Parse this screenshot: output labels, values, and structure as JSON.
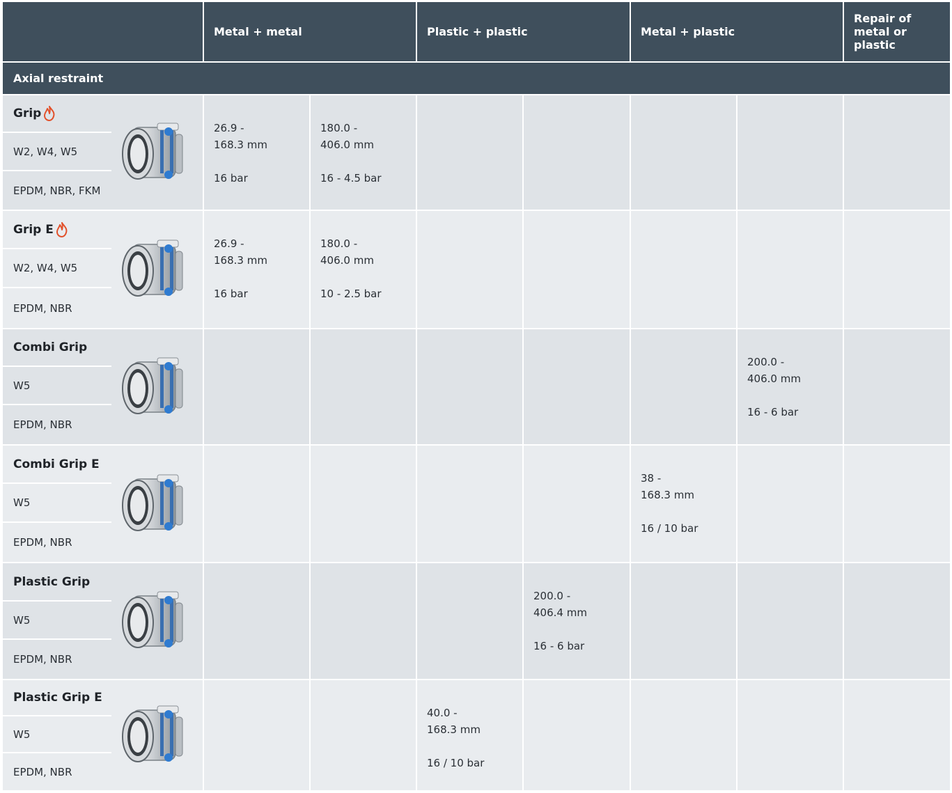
{
  "header": {
    "columns": [
      "Metal + metal",
      "Plastic + plastic",
      "Metal + plastic",
      "Repair of metal or plastic"
    ]
  },
  "section": {
    "title": "Axial restraint"
  },
  "rows": [
    {
      "name": "Grip",
      "flame": true,
      "variants": "W2, W4, W5",
      "materials": "EPDM, NBR, FKM",
      "image": "coupling-image",
      "cells": [
        {
          "col": 0,
          "range": [
            "26.9 -",
            "168.3 mm"
          ],
          "pressure": "16 bar"
        },
        {
          "col": 1,
          "range": [
            "180.0 -",
            "406.0 mm"
          ],
          "pressure": "16 - 4.5 bar"
        }
      ]
    },
    {
      "name": "Grip E",
      "flame": true,
      "variants": "W2, W4, W5",
      "materials": "EPDM, NBR",
      "image": "coupling-image",
      "cells": [
        {
          "col": 0,
          "range": [
            "26.9 -",
            "168.3 mm"
          ],
          "pressure": "16 bar"
        },
        {
          "col": 1,
          "range": [
            "180.0 -",
            "406.0 mm"
          ],
          "pressure": "10 - 2.5 bar"
        }
      ]
    },
    {
      "name": "Combi Grip",
      "flame": false,
      "variants": "W5",
      "materials": "EPDM, NBR",
      "image": "coupling-image",
      "cells": [
        {
          "col": 5,
          "range": [
            "200.0 -",
            "406.0 mm"
          ],
          "pressure": "16 - 6 bar"
        }
      ]
    },
    {
      "name": "Combi Grip E",
      "flame": false,
      "variants": "W5",
      "materials": "EPDM, NBR",
      "image": "coupling-image",
      "cells": [
        {
          "col": 4,
          "range": [
            "38 -",
            "168.3 mm"
          ],
          "pressure": "16 / 10 bar"
        }
      ]
    },
    {
      "name": "Plastic Grip",
      "flame": false,
      "variants": "W5",
      "materials": "EPDM, NBR",
      "image": "coupling-image",
      "cells": [
        {
          "col": 3,
          "range": [
            "200.0 -",
            "406.4 mm"
          ],
          "pressure": "16 - 6 bar"
        }
      ]
    },
    {
      "name": "Plastic Grip E",
      "flame": false,
      "variants": "W5",
      "materials": "EPDM, NBR",
      "image": "coupling-image",
      "cells": [
        {
          "col": 2,
          "range": [
            "40.0 -",
            "168.3 mm"
          ],
          "pressure": "16 / 10 bar"
        }
      ]
    }
  ],
  "colors": {
    "header": "#3f4f5c",
    "row_light": "#e9ecef",
    "row_dark": "#dfe3e7",
    "flame": "#e2512b"
  }
}
